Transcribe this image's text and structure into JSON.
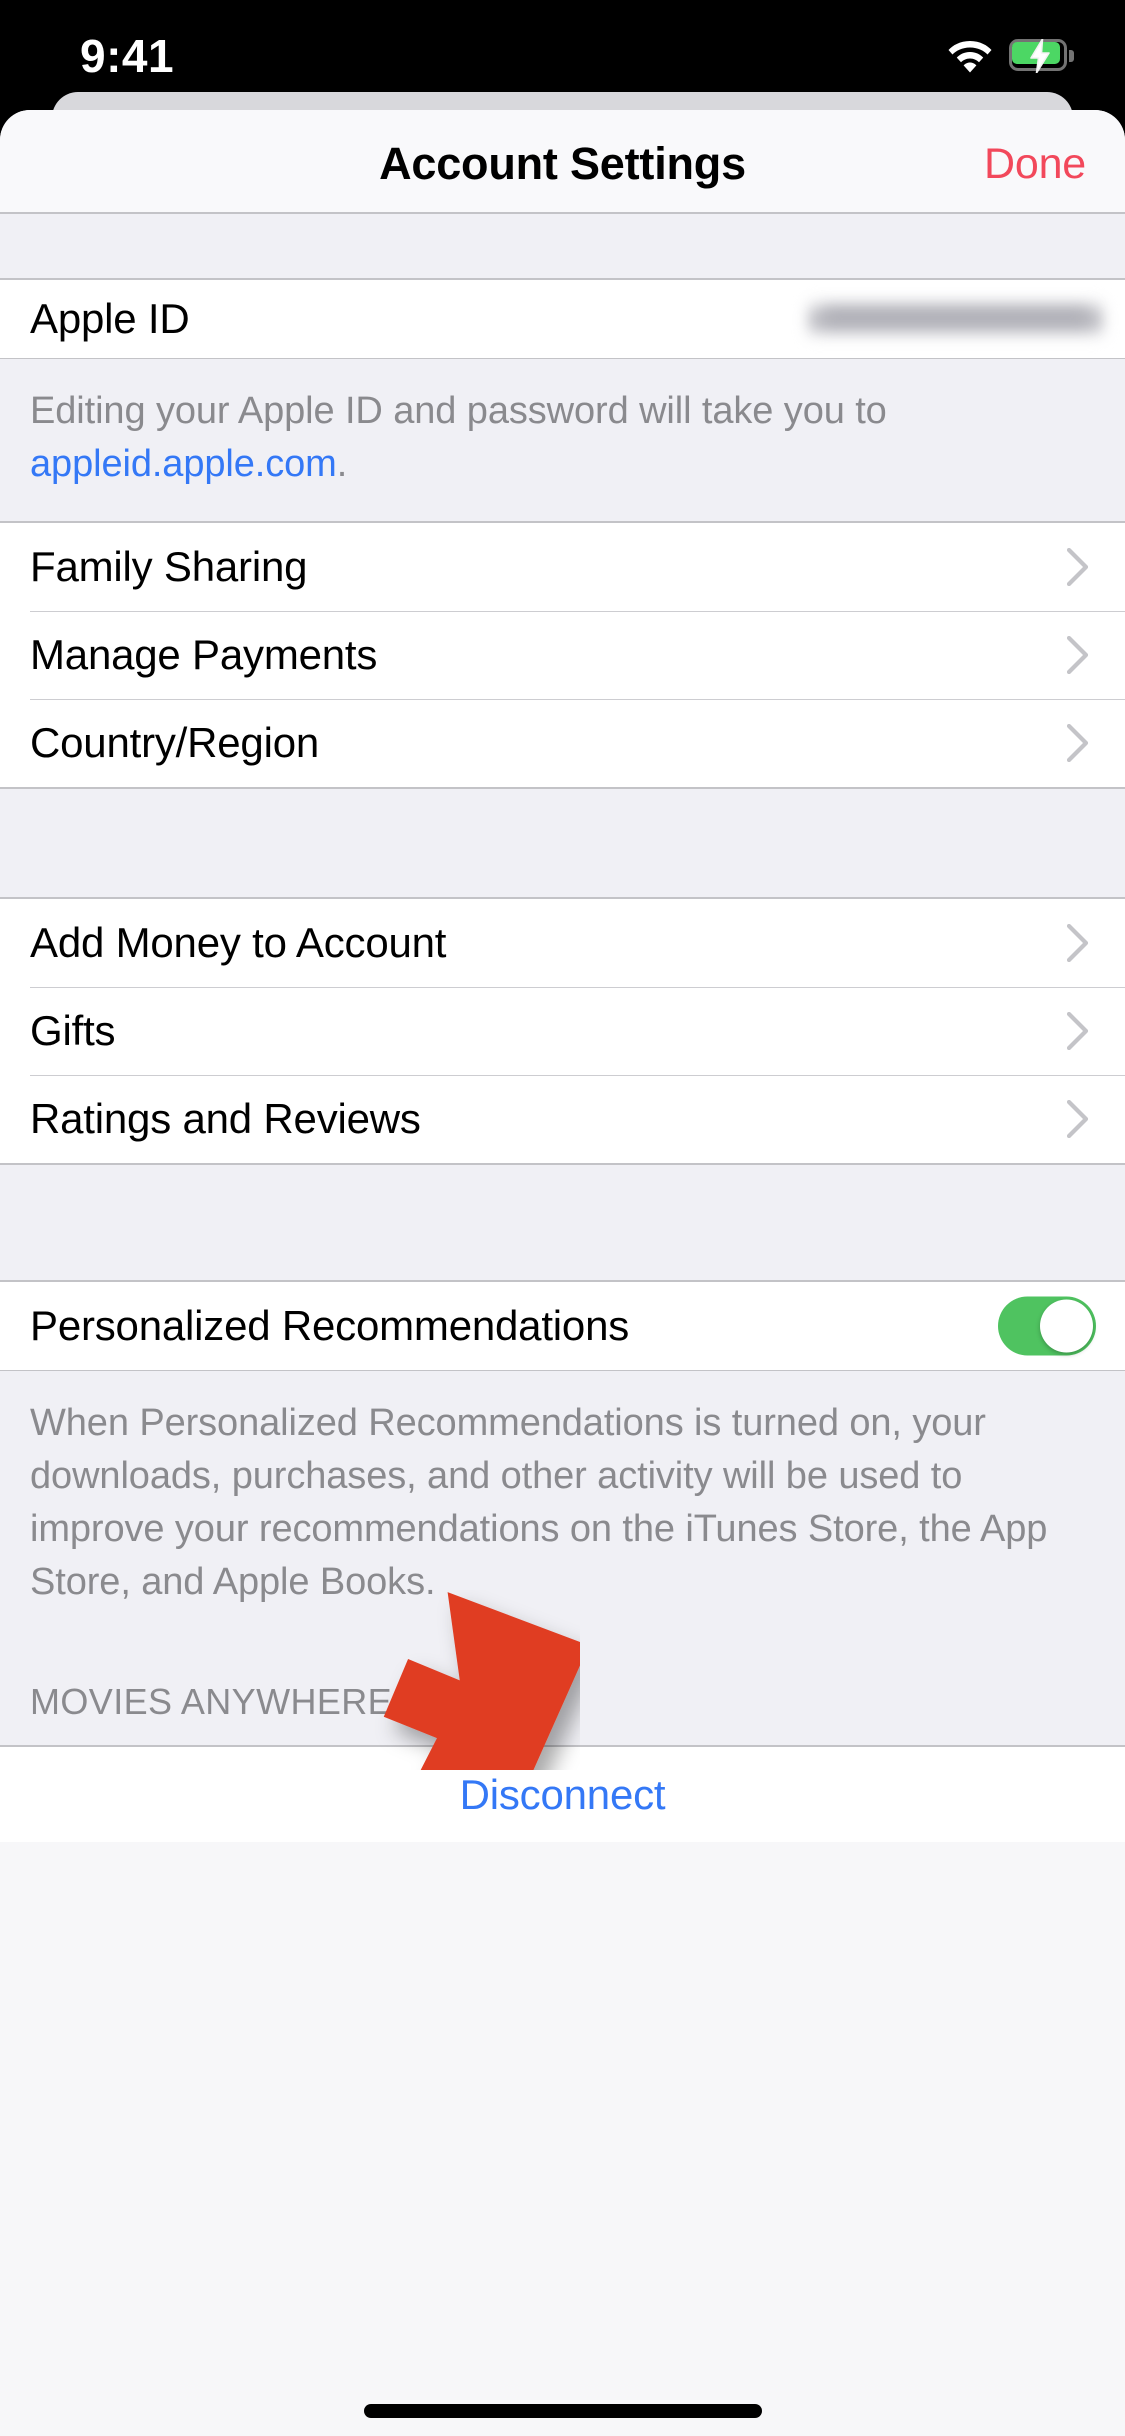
{
  "status_bar": {
    "time": "9:41",
    "wifi_icon": "wifi-icon",
    "battery_icon": "battery-charging-icon"
  },
  "header": {
    "title": "Account Settings",
    "done_label": "Done"
  },
  "sections": {
    "apple_id": {
      "label": "Apple ID",
      "value_redacted": true,
      "footer_prefix": "Editing your Apple ID and password will take you to ",
      "footer_link": "appleid.apple.com",
      "footer_suffix": "."
    },
    "account_group": {
      "rows": [
        {
          "label": "Family Sharing",
          "accessory": "chevron-right-icon"
        },
        {
          "label": "Manage Payments",
          "accessory": "chevron-right-icon"
        },
        {
          "label": "Country/Region",
          "accessory": "chevron-right-icon"
        }
      ]
    },
    "store_group": {
      "rows": [
        {
          "label": "Add Money to Account",
          "accessory": "chevron-right-icon"
        },
        {
          "label": "Gifts",
          "accessory": "chevron-right-icon"
        },
        {
          "label": "Ratings and Reviews",
          "accessory": "chevron-right-icon"
        }
      ]
    },
    "recommendations": {
      "label": "Personalized Recommendations",
      "toggle_state": "on",
      "footer": "When Personalized Recommendations is turned on, your downloads, purchases, and other activity will be used to improve your recommendations on the iTunes Store, the App Store, and Apple Books."
    },
    "movies_anywhere": {
      "header": "MOVIES ANYWHERE:",
      "disconnect_label": "Disconnect"
    }
  },
  "annotation": {
    "arrow_color": "#e03c22",
    "points_at": "Ratings and Reviews"
  },
  "colors": {
    "accent_done": "#f2485b",
    "link_blue": "#3478f6",
    "toggle_green": "#4fc360",
    "group_bg": "#ffffff",
    "page_bg": "#f0f0f5",
    "secondary_text": "#8a8a8e"
  }
}
